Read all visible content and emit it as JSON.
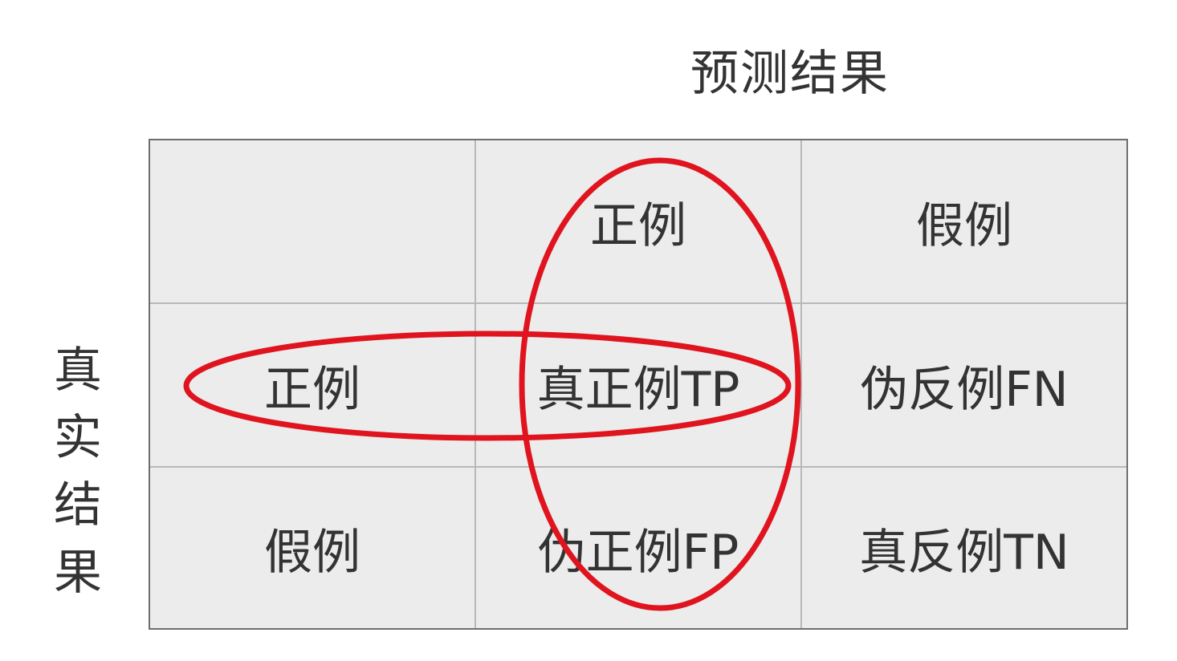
{
  "predicted_label": "预测结果",
  "actual_label_chars": [
    "真",
    "实",
    "结",
    "果"
  ],
  "matrix": {
    "header": [
      "",
      "正例",
      "假例"
    ],
    "rows": [
      [
        "正例",
        "真正例TP",
        "伪反例FN"
      ],
      [
        "假例",
        "伪正例FP",
        "真反例TN"
      ]
    ]
  },
  "highlight_color": "#e0141e"
}
